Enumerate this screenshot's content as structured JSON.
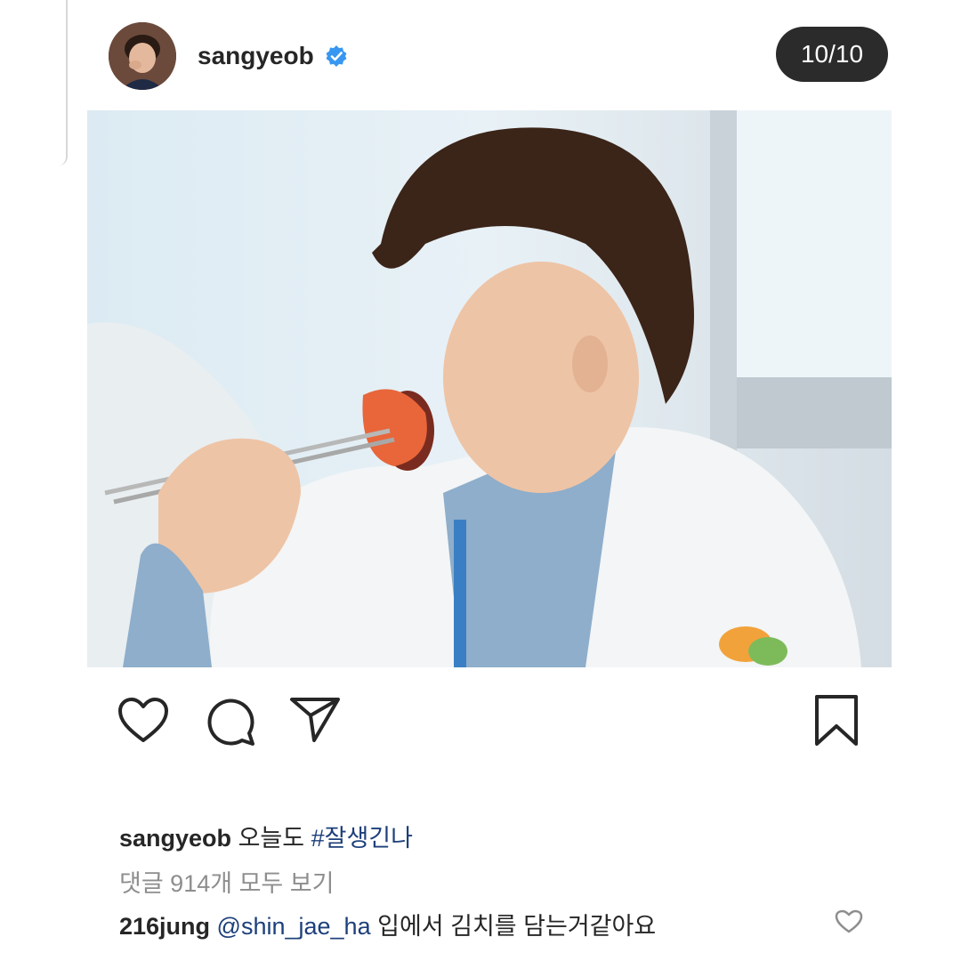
{
  "header": {
    "username": "sangyeob",
    "verified": true,
    "page_counter": "10/10"
  },
  "post": {
    "image_description_icon": "photo",
    "actions": [
      "heart-icon",
      "comment-icon",
      "share-icon",
      "bookmark-icon"
    ]
  },
  "caption": {
    "username": "sangyeob",
    "text": "오늘도",
    "hashtag": "#잘생긴나"
  },
  "view_comments": "댓글 914개 모두 보기",
  "comment": {
    "username": "216jung",
    "mention": "@shin_jae_ha",
    "text": "입에서 김치를 담는거같아요"
  },
  "colors": {
    "text": "#262626",
    "muted": "#8e8e8e",
    "link": "#1d3f7a",
    "verified_blue": "#3897f0",
    "counter_bg": "#2b2b2b"
  }
}
